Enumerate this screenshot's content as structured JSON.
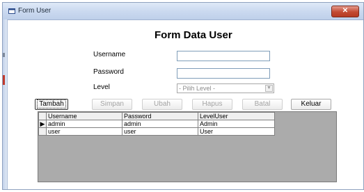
{
  "window": {
    "title": "Form User",
    "close_label": "✕"
  },
  "form": {
    "heading": "Form Data User",
    "fields": [
      {
        "label": "Username",
        "value": ""
      },
      {
        "label": "Password",
        "value": ""
      },
      {
        "label": "Level",
        "selected": "- Pilih Level -"
      }
    ]
  },
  "buttons": {
    "tambah": "Tambah",
    "simpan": "Simpan",
    "ubah": "Ubah",
    "hapus": "Hapus",
    "batal": "Batal",
    "keluar": "Keluar"
  },
  "grid": {
    "columns": [
      "Username",
      "Password",
      "LevelUser"
    ],
    "current_row_marker": "▶",
    "rows": [
      [
        "admin",
        "admin",
        "Admin"
      ],
      [
        "user",
        "user",
        "User"
      ]
    ]
  }
}
